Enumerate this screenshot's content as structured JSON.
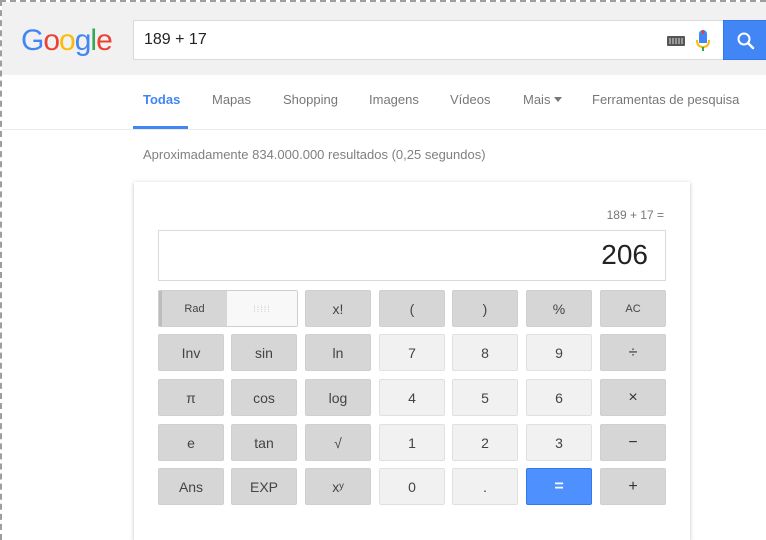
{
  "search": {
    "logo": "Google",
    "query": "189 + 17"
  },
  "nav": {
    "items": [
      "Todas",
      "Mapas",
      "Shopping",
      "Imagens",
      "Vídeos",
      "Mais",
      "Ferramentas de pesquisa"
    ]
  },
  "results": {
    "stats": "Aproximadamente 834.000.000 resultados (0,25 segundos)"
  },
  "calculator": {
    "expression": "189 + 17 =",
    "result": "206",
    "rad_label": "Rad",
    "deg_label": "⁞⁞⁞⁞⁞",
    "keys": [
      "x!",
      "(",
      ")",
      "%",
      "AC",
      "Inv",
      "sin",
      "ln",
      "7",
      "8",
      "9",
      "÷",
      "π",
      "cos",
      "log",
      "4",
      "5",
      "6",
      "×",
      "e",
      "tan",
      "√",
      "1",
      "2",
      "3",
      "−",
      "Ans",
      "EXP",
      "xʸ",
      "0",
      ".",
      "=",
      "+"
    ]
  },
  "colors": {
    "accent": "#4285f4",
    "equals_key": "#4d90fe"
  }
}
